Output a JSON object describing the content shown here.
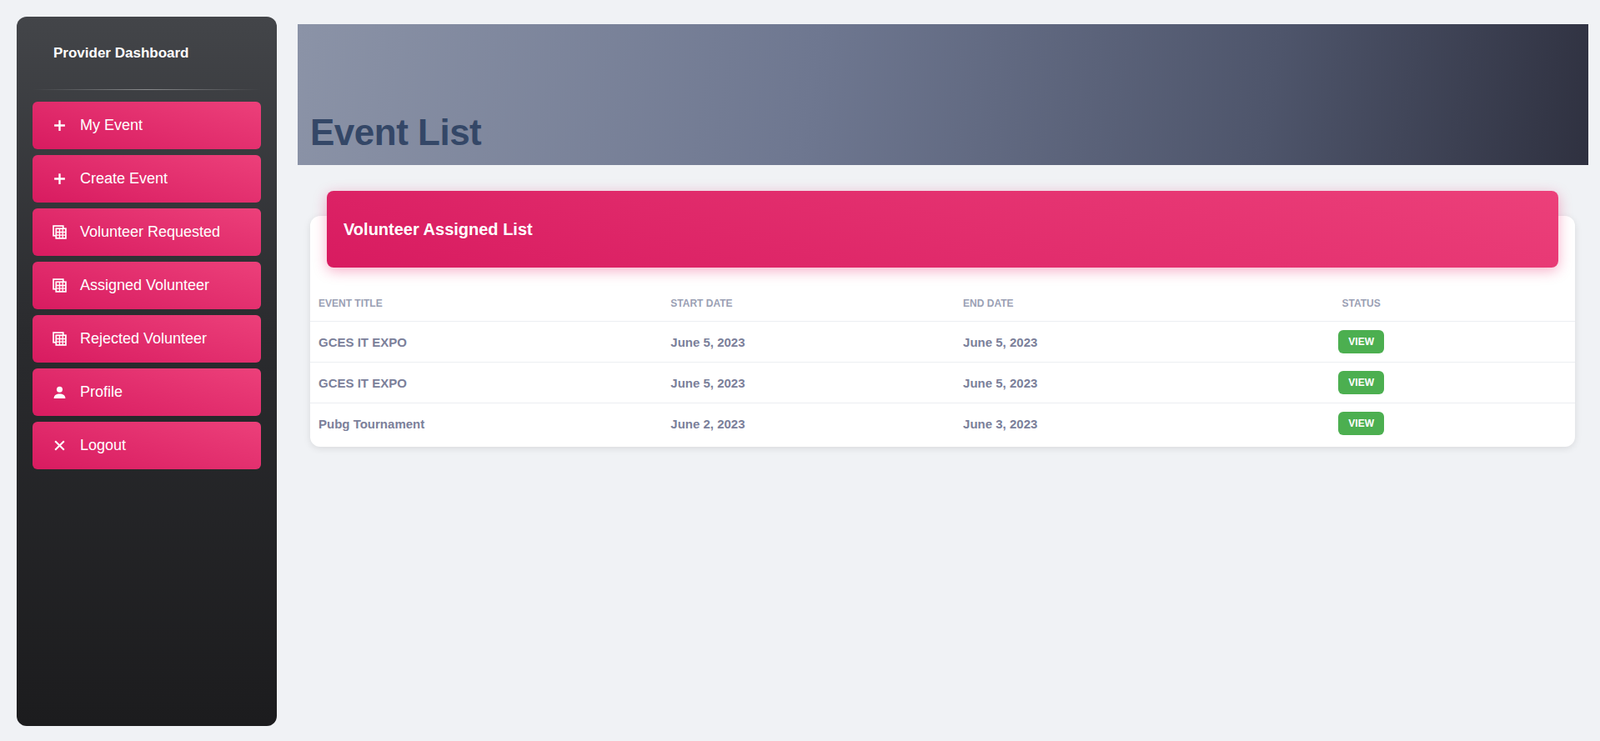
{
  "sidebar": {
    "title": "Provider Dashboard",
    "items": [
      {
        "label": "My Event"
      },
      {
        "label": "Create Event"
      },
      {
        "label": "Volunteer Requested"
      },
      {
        "label": "Assigned Volunteer"
      },
      {
        "label": "Rejected Volunteer"
      },
      {
        "label": "Profile"
      },
      {
        "label": "Logout"
      }
    ]
  },
  "header": {
    "title": "Event List"
  },
  "card": {
    "title": "Volunteer Assigned List"
  },
  "table": {
    "columns": [
      "EVENT TITLE",
      "START DATE",
      "END DATE",
      "STATUS"
    ],
    "rows": [
      {
        "title": "GCES IT EXPO",
        "start": "June 5, 2023",
        "end": "June 5, 2023",
        "status": "VIEW"
      },
      {
        "title": "GCES IT EXPO",
        "start": "June 5, 2023",
        "end": "June 5, 2023",
        "status": "VIEW"
      },
      {
        "title": "Pubg Tournament",
        "start": "June 2, 2023",
        "end": "June 3, 2023",
        "status": "VIEW"
      }
    ]
  }
}
